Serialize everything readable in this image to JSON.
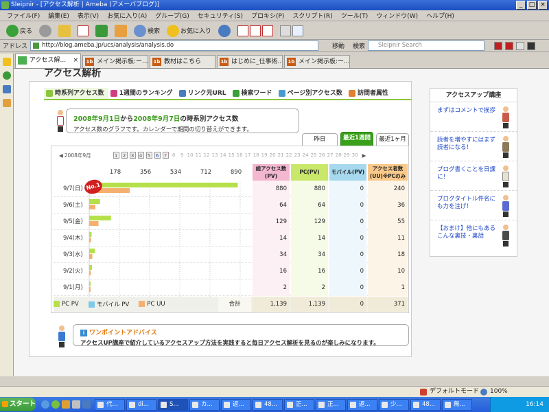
{
  "window": {
    "title": "Sleipnir - [アクセス解析 | Ameba (アメーバブログ)]"
  },
  "menu": [
    "ファイル(F)",
    "編集(E)",
    "表示(V)",
    "お気に入り(A)",
    "グループ(G)",
    "セキュリティ(S)",
    "プロキシ(P)",
    "スクリプト(R)",
    "ツール(T)",
    "ウィンドウ(W)",
    "ヘルプ(H)"
  ],
  "toolbar": {
    "back": "戻る",
    "search": "検索",
    "favorites": "お気に入り"
  },
  "address": {
    "label": "アドレス",
    "url": "http://blog.ameba.jp/ucs/analysis/analysis.do",
    "go": "移動",
    "search_label": "検索",
    "search_placeholder": "Sleipnir Search"
  },
  "tabs": [
    {
      "label": "アクセス解..."
    },
    {
      "label": "メイン掲示板:ー..."
    },
    {
      "label": "教材はこちら"
    },
    {
      "label": "はじめに_仕事術..."
    },
    {
      "label": "メイン掲示板:ー..."
    }
  ],
  "page": {
    "title": "アクセス解析",
    "nav": [
      "時系列アクセス数",
      "1週間のランキング",
      "リンク元URL",
      "検索ワード",
      "ページ別アクセス数",
      "訪問者属性"
    ],
    "bubble_from": "2008年9月1日",
    "bubble_mid": "から",
    "bubble_to": "2008年9月7日",
    "bubble_suffix": "の時系別アクセス数",
    "bubble_desc": "アクセス数のグラフです。カレンダーで期間の切り替えができます。",
    "period": [
      "昨日",
      "最近1週間",
      "最近1ヶ月"
    ],
    "cal_month": "2008年9月",
    "cal_days": [
      "1",
      "2",
      "3",
      "4",
      "5",
      "6",
      "7",
      "8",
      "9",
      "10",
      "11",
      "12",
      "13",
      "14",
      "15",
      "16",
      "17",
      "18",
      "19",
      "20",
      "21",
      "22",
      "23",
      "24",
      "25",
      "26",
      "27",
      "28",
      "29",
      "30"
    ],
    "axis_ticks": [
      "178",
      "356",
      "534",
      "712",
      "890"
    ],
    "col_headers": [
      "総アクセス数(PV)",
      "PC(PV)",
      "モバイル(PV)",
      "アクセス者数(UU)※PCのみ"
    ],
    "rank_badge": "No.1",
    "total_label": "合計",
    "legend": [
      "PC PV",
      "モバイル PV",
      "PC UU"
    ],
    "advice_title": "ワンポイントアドバイス",
    "advice_body": "アクセスUP講座で紹介しているアクセスアップ方法を実践すると毎日アクセス解析を見るのが楽しみになります。"
  },
  "rows": [
    {
      "date": "9/7(日)",
      "total": "880",
      "pc": "880",
      "mobile": "0",
      "uu": "240"
    },
    {
      "date": "9/6(土)",
      "total": "64",
      "pc": "64",
      "mobile": "0",
      "uu": "36"
    },
    {
      "date": "9/5(金)",
      "total": "129",
      "pc": "129",
      "mobile": "0",
      "uu": "55"
    },
    {
      "date": "9/4(木)",
      "total": "14",
      "pc": "14",
      "mobile": "0",
      "uu": "11"
    },
    {
      "date": "9/3(水)",
      "total": "34",
      "pc": "34",
      "mobile": "0",
      "uu": "18"
    },
    {
      "date": "9/2(火)",
      "total": "16",
      "pc": "16",
      "mobile": "0",
      "uu": "10"
    },
    {
      "date": "9/1(月)",
      "total": "2",
      "pc": "2",
      "mobile": "0",
      "uu": "1"
    }
  ],
  "totals": {
    "total": "1,139",
    "pc": "1,139",
    "mobile": "0",
    "uu": "371"
  },
  "chart_data": {
    "type": "bar",
    "categories": [
      "9/7(日)",
      "9/6(土)",
      "9/5(金)",
      "9/4(木)",
      "9/3(水)",
      "9/2(火)",
      "9/1(月)"
    ],
    "series": [
      {
        "name": "PC PV",
        "values": [
          880,
          64,
          129,
          14,
          34,
          16,
          2
        ]
      },
      {
        "name": "モバイル PV",
        "values": [
          0,
          0,
          0,
          0,
          0,
          0,
          0
        ]
      },
      {
        "name": "PC UU",
        "values": [
          240,
          36,
          55,
          11,
          18,
          10,
          1
        ]
      }
    ],
    "xlim": [
      0,
      890
    ],
    "colors": {
      "pc_pv": "#b5e04a",
      "mobile_pv": "#7ec8e8",
      "pc_uu": "#f5b070"
    }
  },
  "right": {
    "title": "アクセスアップ講座",
    "items": [
      "まずはコメントで挨拶",
      "読者を増やすにはまず読者になる！",
      "ブログ書くことを日課に！",
      "ブログタイトル件名にも力を注げ！",
      "【おまけ】他にもあるこんな裏技・裏話"
    ]
  },
  "status": {
    "mode": "デフォルトモード",
    "zoom": "100%"
  },
  "taskbar": {
    "start": "スタート",
    "items": [
      "代...",
      "di...",
      "S...",
      "カ...",
      "返...",
      "48...",
      "正...",
      "正...",
      "返...",
      "少...",
      "48...",
      "無..."
    ],
    "clock": "16:14"
  }
}
